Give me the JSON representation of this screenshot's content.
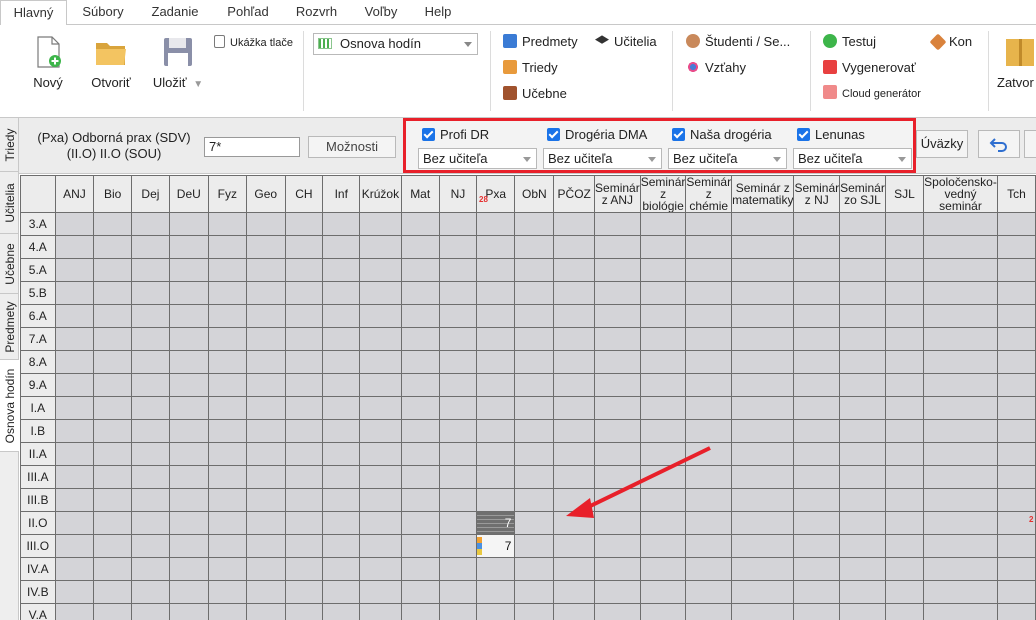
{
  "menu": {
    "tabs": [
      "Hlavný",
      "Súbory",
      "Zadanie",
      "Pohľad",
      "Rozvrh",
      "Voľby",
      "Help"
    ],
    "active": "Hlavný"
  },
  "ribbon": {
    "new_label": "Nový",
    "open_label": "Otvoriť",
    "save_label": "Uložiť",
    "print_preview_label": "Ukážka tlače",
    "view_combo_value": "Osnova hodín",
    "subjects_label": "Predmety",
    "teachers_label": "Učitelia",
    "classes_label": "Triedy",
    "relations_label": "Vzťahy",
    "rooms_label": "Učebne",
    "students_label": "Študenti / Se...",
    "test_label": "Testuj",
    "generate_label": "Vygenerovať",
    "cloud_label": "Cloud generátor",
    "con_label": "Kon",
    "close_label": "Zatvor"
  },
  "side_tabs": [
    "Triedy",
    "Učitelia",
    "Učebne",
    "Predmety",
    "Osnova hodín"
  ],
  "toolbar": {
    "subject_line1": "(Pxa) Odborná prax (SDV)",
    "subject_line2": "(II.O) II.O (SOU)",
    "hours_value": "7*",
    "options_label": "Možnosti",
    "uvazky_label": "Úväzky"
  },
  "teacher_panel": {
    "groups": [
      {
        "label": "Profi DR",
        "teacher": "Bez učiteľa"
      },
      {
        "label": "Drogéria DMA",
        "teacher": "Bez učiteľa"
      },
      {
        "label": "Naša drogéria",
        "teacher": "Bez učiteľa"
      },
      {
        "label": "Lenunas",
        "teacher": "Bez učiteľa"
      }
    ]
  },
  "grid": {
    "columns": [
      "ANJ",
      "Bio",
      "Dej",
      "DeU",
      "Fyz",
      "Geo",
      "CH",
      "Inf",
      "Krúžok",
      "Mat",
      "NJ",
      "Pxa",
      "ObN",
      "PČOZ",
      "Seminár z ANJ",
      "Seminár z biológie",
      "Seminár z chémie",
      "Seminár z matematiky",
      "Seminár z NJ",
      "Seminár zo SJL",
      "SJL",
      "Spoločensko-vedný seminár",
      "Tch"
    ],
    "rows": [
      "3.A",
      "4.A",
      "5.A",
      "5.B",
      "6.A",
      "7.A",
      "8.A",
      "9.A",
      "I.A",
      "I.B",
      "II.A",
      "III.A",
      "III.B",
      "II.O",
      "III.O",
      "IV.A",
      "IV.B",
      "V.A"
    ],
    "pxa_badge": "28",
    "right_badge": "2",
    "assignments": [
      {
        "row": "II.O",
        "column": "Pxa",
        "value": "7",
        "style": "selected"
      },
      {
        "row": "III.O",
        "column": "Pxa",
        "value": "7",
        "style": "normal"
      }
    ]
  },
  "colors": {
    "highlight_border": "#e8202a",
    "checkbox": "#1a73e8",
    "grid_cell": "#d4d4d8",
    "badge": "#e53030"
  }
}
